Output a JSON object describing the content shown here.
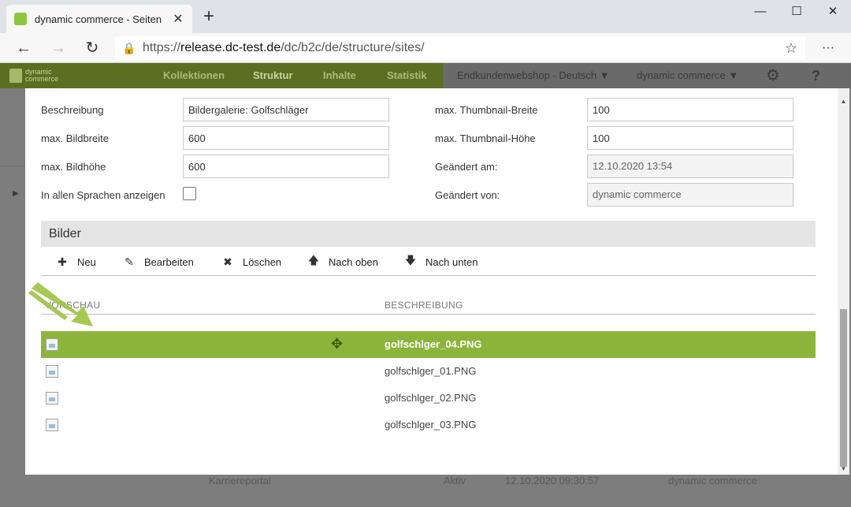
{
  "browser": {
    "tab_title": "dynamic commerce - Seiten",
    "tab_close": "✕",
    "new_tab": "+",
    "url_prefix": "https://",
    "url_host": "release.dc-test.de",
    "url_path": "/dc/b2c/de/structure/sites/",
    "more": "···"
  },
  "app": {
    "logo_text_1": "dynamic",
    "logo_text_2": "commerce",
    "menu": [
      "Kollektionen",
      "Struktur",
      "Inhalte",
      "Statistik"
    ],
    "shop_select": "Endkundenwebshop - Deutsch",
    "user_select": "dynamic commerce",
    "help": "?"
  },
  "background_row": {
    "name": "Karriereportal",
    "status": "Aktiv",
    "date": "12.10.2020 09:30:57",
    "user": "dynamic commerce"
  },
  "form": {
    "left": [
      {
        "label": "Beschreibung",
        "value": "Bildergalerie: Golfschläger"
      },
      {
        "label": "max. Bildbreite",
        "value": "600"
      },
      {
        "label": "max. Bildhöhe",
        "value": "600"
      },
      {
        "label": "In allen Sprachen anzeigen",
        "checked": false
      }
    ],
    "right": [
      {
        "label": "max. Thumbnail-Breite",
        "value": "100"
      },
      {
        "label": "max. Thumbnail-Höhe",
        "value": "100"
      },
      {
        "label": "Geändert am:",
        "value": "12.10.2020 13:54"
      },
      {
        "label": "Geändert von:",
        "value": "dynamic commerce"
      }
    ]
  },
  "section_title": "Bilder",
  "toolbar": {
    "new": "Neu",
    "edit": "Bearbeiten",
    "delete": "Löschen",
    "up": "Nach oben",
    "down": "Nach unten"
  },
  "table": {
    "columns": [
      "VORSCHAU",
      "BESCHREIBUNG"
    ],
    "rows": [
      {
        "name": "golfschlger_04.PNG",
        "selected": true
      },
      {
        "name": "golfschlger_01.PNG",
        "selected": false
      },
      {
        "name": "golfschlger_02.PNG",
        "selected": false
      },
      {
        "name": "golfschlger_03.PNG",
        "selected": false
      }
    ]
  },
  "colors": {
    "accent": "#8cb43b",
    "header": "#5a6f22"
  }
}
